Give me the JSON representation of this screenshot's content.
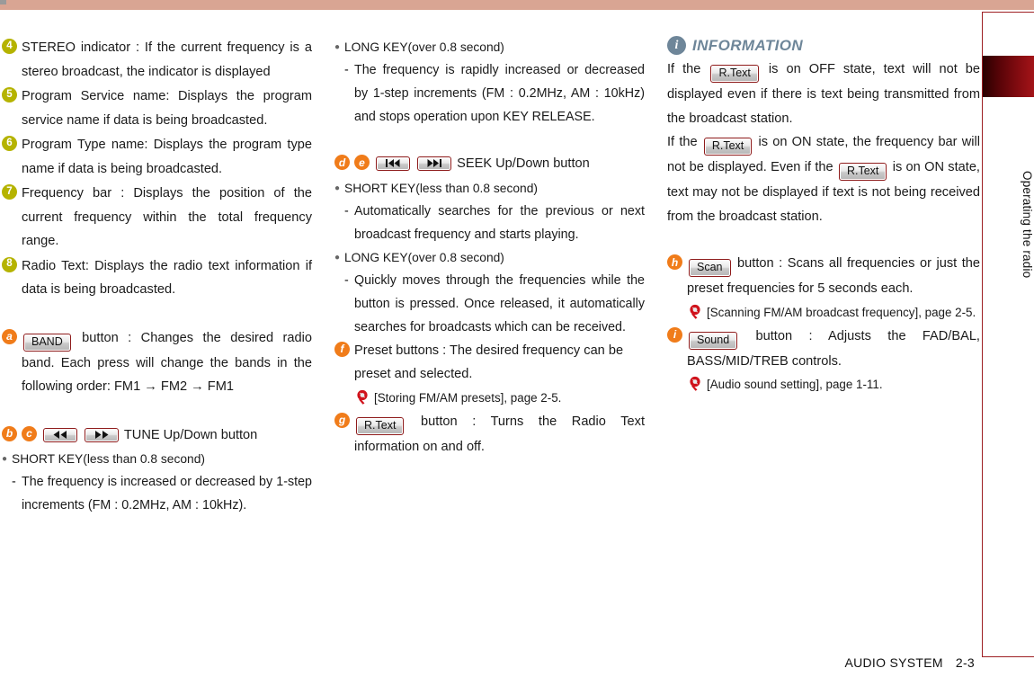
{
  "page": {
    "footer_title": "AUDIO SYSTEM",
    "footer_page": "2-3",
    "side_tab_label": "Operating the radio",
    "top_bar_color": "#d9a593",
    "marker_number_color": "#b5b300",
    "marker_letter_color": "#f07c1a",
    "button_border_color": "#8e1b1b",
    "information_color": "#6e8699",
    "reference_pin_color": "#d0121b"
  },
  "left_column": {
    "numbered_items": [
      {
        "marker": "4",
        "text": "STEREO indicator : If the current frequency is a stereo broadcast, the indicator is displayed"
      },
      {
        "marker": "5",
        "text": "Program Service name: Displays the program service name if data is being broadcasted."
      },
      {
        "marker": "6",
        "text": "Program Type name: Displays the program type name if data is being broadcasted."
      },
      {
        "marker": "7",
        "text": "Frequency bar : Displays the position of the current frequency within the total frequency range."
      },
      {
        "marker": "8",
        "text": "Radio Text: Displays the radio text information if data is being broadcasted."
      }
    ],
    "band_item": {
      "marker": "a",
      "button_label": "BAND",
      "text": "button : Changes the desired radio band. Each press will change the bands in the following order: FM1 → FM2 → FM1"
    },
    "tune_item": {
      "marker_1": "b",
      "marker_2": "c",
      "button_1_icon": "rewind-icon",
      "button_2_icon": "fast-forward-icon",
      "title": "TUNE Up/Down button",
      "bullets": [
        {
          "type": "dot",
          "text": "SHORT KEY(less than 0.8 second)"
        },
        {
          "type": "dash",
          "text": "The frequency is increased or decreased by 1-step increments (FM : 0.2MHz, AM : 10kHz)."
        }
      ]
    }
  },
  "middle_column": {
    "long_key_block": {
      "bullets": [
        {
          "type": "dot",
          "text": "LONG KEY(over 0.8 second)"
        },
        {
          "type": "dash",
          "text": "The frequency is rapidly increased or decreased by 1-step increments (FM : 0.2MHz, AM : 10kHz) and stops operation upon KEY RELEASE."
        }
      ]
    },
    "seek_item": {
      "marker_1": "d",
      "marker_2": "e",
      "button_1_icon": "seek-previous-icon",
      "button_2_icon": "seek-next-icon",
      "title": "SEEK Up/Down button",
      "bullets": [
        {
          "type": "dot",
          "text": "SHORT KEY(less than 0.8 second)"
        },
        {
          "type": "dash",
          "text": "Automatically searches for the previous or next broadcast frequency and starts playing."
        },
        {
          "type": "dot",
          "text": "LONG KEY(over 0.8 second)"
        },
        {
          "type": "dash",
          "text": "Quickly moves through the frequencies while the button is pressed. Once released, it automatically searches for broadcasts which can be received."
        }
      ]
    },
    "preset_item": {
      "marker": "f",
      "text": "Preset buttons : The desired frequency can be preset and selected.",
      "reference": "[Storing FM/AM presets], page 2-5."
    },
    "rtext_item": {
      "marker": "g",
      "button_label": "R.Text",
      "text": "button : Turns the Radio Text information on and off."
    }
  },
  "right_column": {
    "information": {
      "icon": "info-icon",
      "title": "INFORMATION",
      "paragraph_1_part_1": "If the",
      "paragraph_1_button": "R.Text",
      "paragraph_1_part_2": "is on OFF state, text will not be displayed even if there is text being transmitted from the broadcast station.",
      "paragraph_2_part_1": "If the",
      "paragraph_2_button_1": "R.Text",
      "paragraph_2_part_2": "is on ON state, the frequency bar will not be displayed. Even if the",
      "paragraph_2_button_2": "R.Text",
      "paragraph_2_part_3": "is on ON state, text may not be displayed if text is not being received from the broadcast station."
    },
    "scan_item": {
      "marker": "h",
      "button_label": "Scan",
      "text": "button : Scans all frequencies or just the preset frequencies for 5 seconds each.",
      "reference": "[Scanning FM/AM broadcast frequency], page 2-5."
    },
    "sound_item": {
      "marker": "i",
      "button_label": "Sound",
      "text": "button : Adjusts the FAD/BAL, BASS/MID/TREB controls.",
      "reference": "[Audio sound setting], page 1-11."
    }
  }
}
